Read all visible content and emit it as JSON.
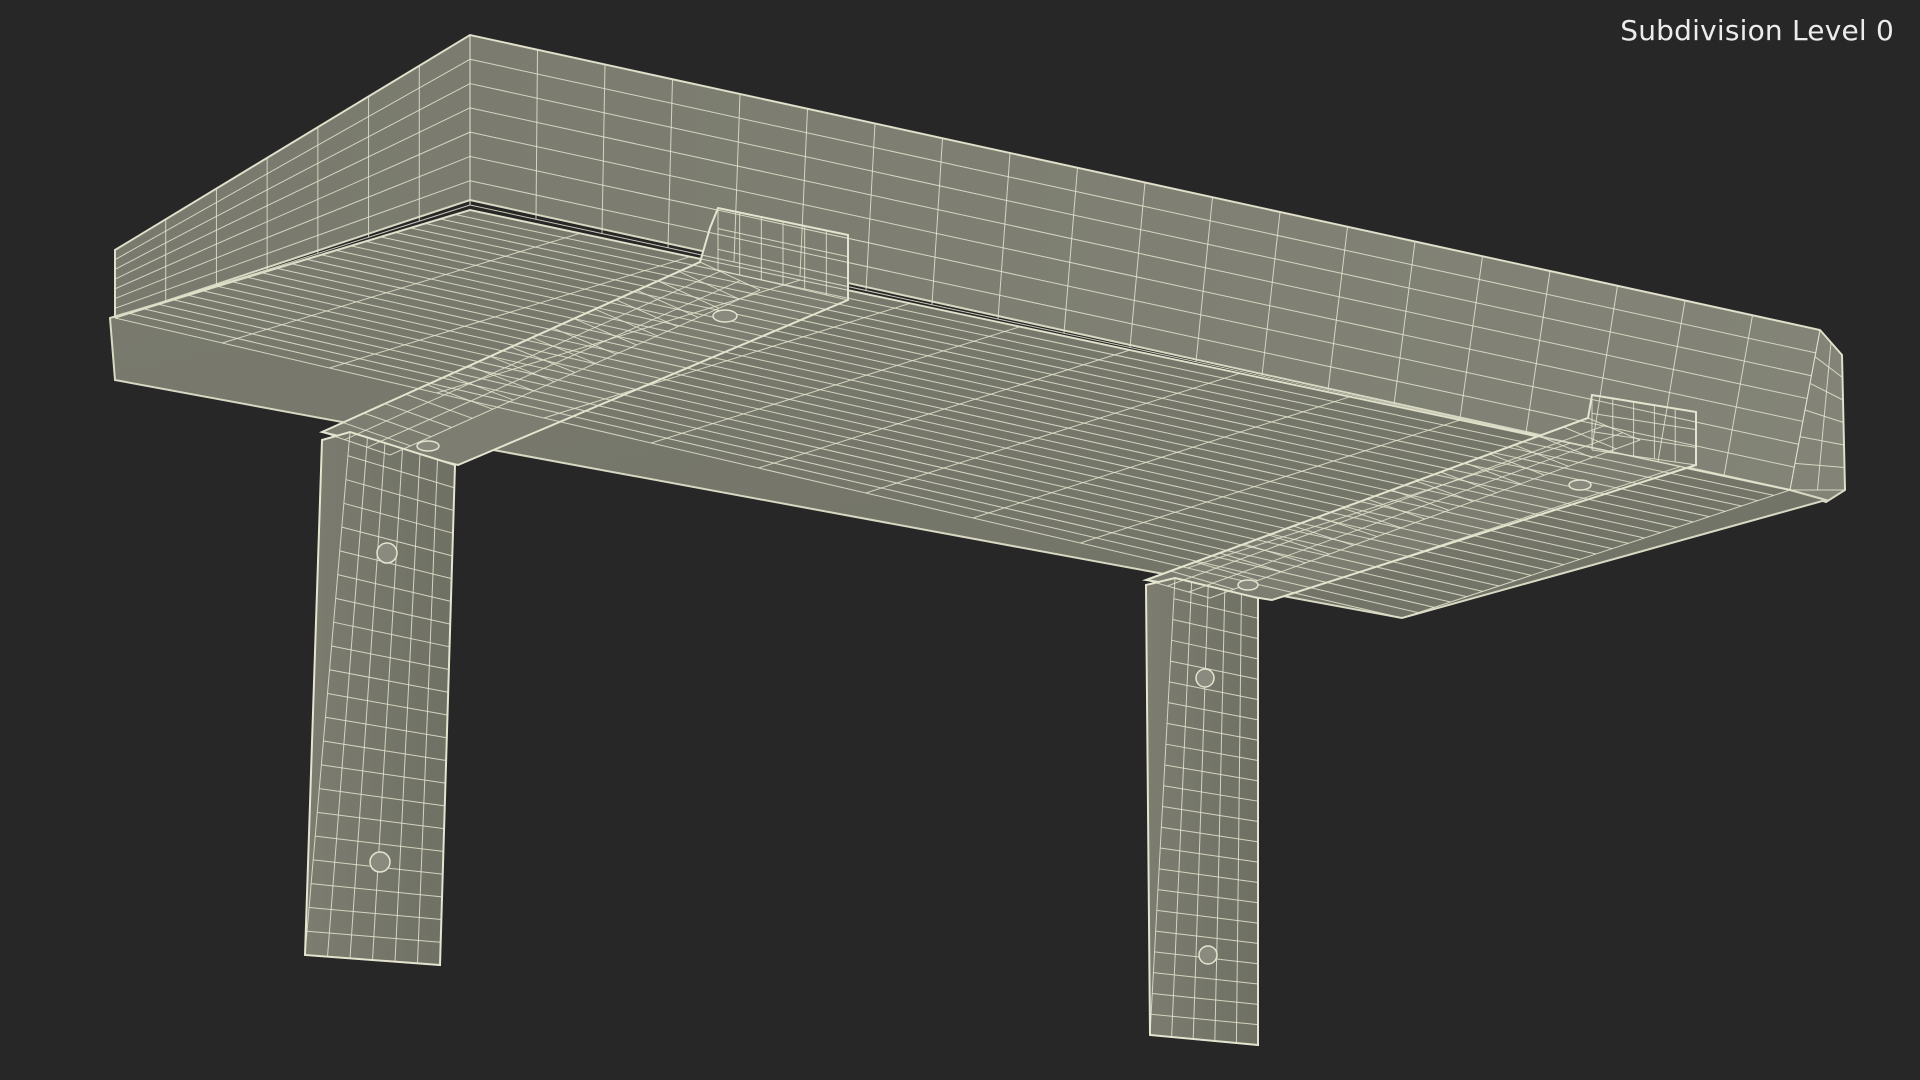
{
  "viewport": {
    "subdivision_label": "Subdivision Level 0",
    "background_color": "#272727",
    "surface_color": "#7a7b6f",
    "wire_color": "#e4e4cf"
  }
}
